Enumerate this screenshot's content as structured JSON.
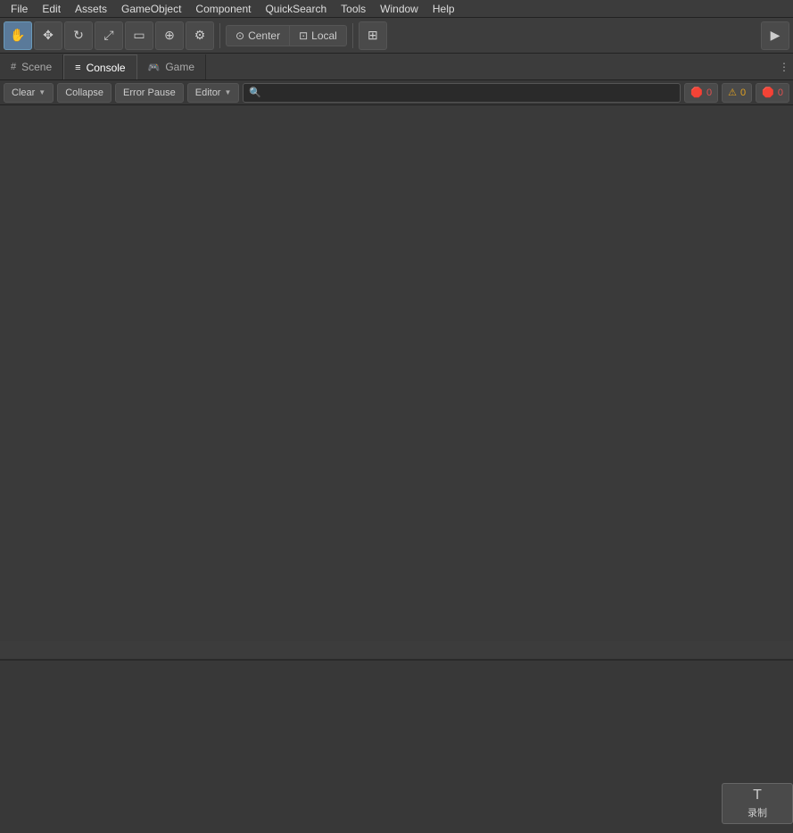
{
  "menubar": {
    "items": [
      "File",
      "Edit",
      "Assets",
      "GameObject",
      "Component",
      "QuickSearch",
      "Tools",
      "Window",
      "Help"
    ]
  },
  "toolbar": {
    "tools": [
      {
        "name": "hand-tool",
        "icon": "✋",
        "active": true
      },
      {
        "name": "move-tool",
        "icon": "✥",
        "active": false
      },
      {
        "name": "rotate-tool",
        "icon": "↻",
        "active": false
      },
      {
        "name": "scale-tool",
        "icon": "⤢",
        "active": false
      },
      {
        "name": "rect-tool",
        "icon": "▭",
        "active": false
      },
      {
        "name": "transform-tool",
        "icon": "⊕",
        "active": false
      },
      {
        "name": "custom-tool",
        "icon": "⚙",
        "active": false
      }
    ],
    "pivot": {
      "center_label": "Center",
      "local_label": "Local"
    },
    "layers_icon": "⊞",
    "play_icon": "▶"
  },
  "tabs": {
    "scene": {
      "label": "Scene",
      "icon": "#",
      "active": false
    },
    "console": {
      "label": "Console",
      "icon": "≡",
      "active": true
    },
    "game": {
      "label": "Game",
      "icon": "🎮",
      "active": false
    }
  },
  "console": {
    "clear_label": "Clear",
    "collapse_label": "Collapse",
    "error_pause_label": "Error Pause",
    "editor_label": "Editor",
    "search_placeholder": "",
    "badges": {
      "error": {
        "icon": "🛑",
        "count": "0"
      },
      "warn": {
        "icon": "⚠",
        "count": "0"
      },
      "info": {
        "icon": "🛑",
        "count": "0"
      }
    }
  },
  "recording": {
    "icon": "T",
    "label": "录制"
  }
}
